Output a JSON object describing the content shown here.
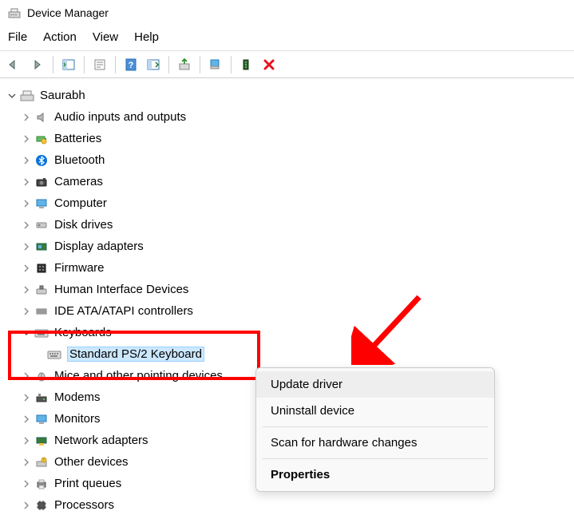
{
  "window": {
    "title": "Device Manager"
  },
  "menubar": {
    "items": [
      "File",
      "Action",
      "View",
      "Help"
    ]
  },
  "tree": {
    "root": "Saurabh",
    "categories": [
      "Audio inputs and outputs",
      "Batteries",
      "Bluetooth",
      "Cameras",
      "Computer",
      "Disk drives",
      "Display adapters",
      "Firmware",
      "Human Interface Devices",
      "IDE ATA/ATAPI controllers",
      "Keyboards",
      "Mice and other pointing devices",
      "Modems",
      "Monitors",
      "Network adapters",
      "Other devices",
      "Print queues",
      "Processors"
    ],
    "keyboards_child": "Standard PS/2 Keyboard"
  },
  "context_menu": {
    "items": [
      "Update driver",
      "Uninstall device",
      "Scan for hardware changes",
      "Properties"
    ]
  }
}
